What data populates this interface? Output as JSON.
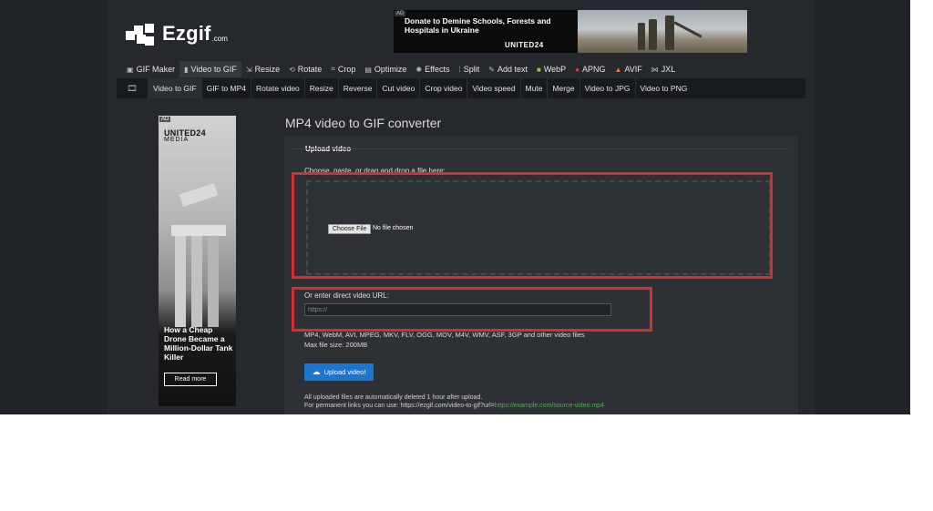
{
  "brand": {
    "name": "Ezgif",
    "tld": ".com"
  },
  "top_ad": {
    "tag": "AD",
    "title": "Donate to Demine Schools, Forests and Hospitals in Ukraine",
    "brand": "UNITED24"
  },
  "main_nav": [
    {
      "label": "GIF Maker",
      "icon": "film-icon"
    },
    {
      "label": "Video to GIF",
      "icon": "video-icon"
    },
    {
      "label": "Resize",
      "icon": "resize-icon"
    },
    {
      "label": "Rotate",
      "icon": "rotate-icon"
    },
    {
      "label": "Crop",
      "icon": "crop-icon"
    },
    {
      "label": "Optimize",
      "icon": "optimize-icon"
    },
    {
      "label": "Effects",
      "icon": "effects-icon"
    },
    {
      "label": "Split",
      "icon": "split-icon"
    },
    {
      "label": "Add text",
      "icon": "text-icon"
    },
    {
      "label": "WebP",
      "icon": "webp-icon"
    },
    {
      "label": "APNG",
      "icon": "apng-icon"
    },
    {
      "label": "AVIF",
      "icon": "avif-icon"
    },
    {
      "label": "JXL",
      "icon": "jxl-icon"
    }
  ],
  "sub_nav": [
    {
      "label": "Video to GIF"
    },
    {
      "label": "GIF to MP4"
    },
    {
      "label": "Rotate video"
    },
    {
      "label": "Resize"
    },
    {
      "label": "Reverse"
    },
    {
      "label": "Cut video"
    },
    {
      "label": "Crop video"
    },
    {
      "label": "Video speed"
    },
    {
      "label": "Mute"
    },
    {
      "label": "Merge"
    },
    {
      "label": "Video to JPG"
    },
    {
      "label": "Video to PNG"
    }
  ],
  "side_ad": {
    "tag": "AD",
    "brand_line1": "UNITED24",
    "brand_line2": "MEDIA",
    "headline": "How a Cheap Drone Became a Million-Dollar Tank Killer",
    "cta": "Read more"
  },
  "main": {
    "title": "MP4 video to GIF converter",
    "legend": "Upload video",
    "instruction": "Choose, paste, or drag and drop a file here:",
    "file_button": "Choose File",
    "file_status": "No file chosen",
    "url_label": "Or enter direct video URL:",
    "url_placeholder": "https://",
    "formats": "MP4, WebM, AVI, MPEG, MKV, FLV, OGG, MOV, M4V, WMV, ASF, 3GP and other video files",
    "max_size": "Max file size: 200MB",
    "upload_button": "Upload video!",
    "note1": "All uploaded files are automatically deleted 1 hour after upload.",
    "note2_prefix": "For permanent links you can use: https://ezgif.com/video-to-gif?url=",
    "note2_example": "https://example.com/source-video.mp4"
  },
  "colors": {
    "highlight": "#d32f2f",
    "upload_button": "#1976d2",
    "example_link": "#4caf50"
  }
}
